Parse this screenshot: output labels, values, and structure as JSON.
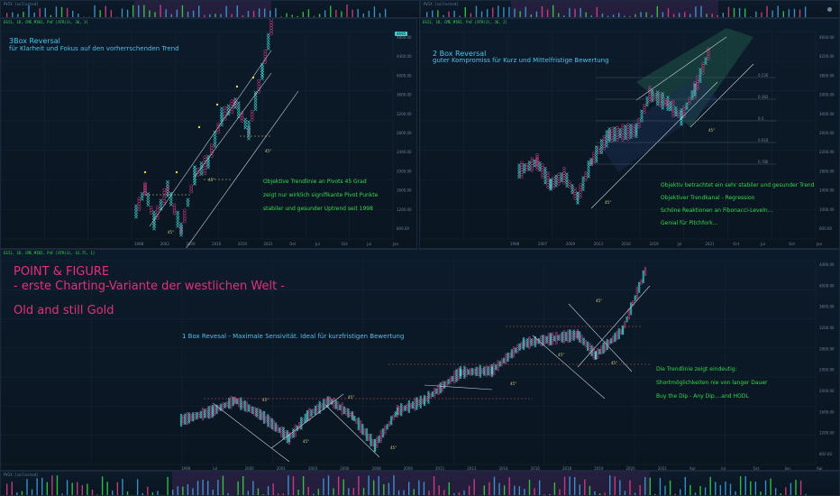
{
  "colors": {
    "bg": "#0b1522",
    "rise": "#3fd6d0",
    "fall": "#e0418c",
    "grid": "#15283a",
    "cyan_text": "#4ec3e6",
    "green_text": "#36d94a",
    "pink_text": "#e3317a",
    "trend": "#c8d2dc"
  },
  "top_volume_left": {
    "label": "PVIX [sollected]"
  },
  "top_volume_right": {
    "label": "PVIX [sollected]"
  },
  "panel_top_left": {
    "header": "ESI1, 1D, CME_MINI, PnF [ATR(3), 36, 3]",
    "title": "3Box Reversal",
    "subtitle": "für Klarheit und Fokus auf den vorherrschenden Trend",
    "notes": [
      "Objektive Trendlinie an Pivots 45 Grad",
      "zeigt nur wirklich signifikante Pivot Punkte",
      "stabiler und gesunder Uptrend seit 1998"
    ],
    "x_ticks": [
      "1998",
      "2002",
      "2009",
      "2016",
      "2019",
      "2021",
      "Oct",
      "Jul",
      "Oct",
      "Jul",
      "Jan"
    ],
    "y_ticks": [
      "4800.00",
      "4400.00",
      "4000.00",
      "3600.00",
      "3200.00",
      "2800.00",
      "2400.00",
      "2000.00",
      "1600.00",
      "1200.00",
      "800.00"
    ],
    "angle_labels": [
      "45°",
      "45°",
      "45°"
    ]
  },
  "panel_top_right": {
    "header": "ESI1, 1D, CME_MINI, PnF [ATR(3), 36, 2]",
    "title": "2 Box Reversal",
    "subtitle": "guter Kompromiss für Kurz und Mittelfristige Bewertung",
    "notes": [
      "Objektiv betrachtet ein sehr stabiler und gesunder Trend",
      "Objektiver Trendkanal - Regression",
      "Schöne Reaktionen an Fibonacci-Leveln...",
      "Genial für Pitchfork..."
    ],
    "fib_labels": [
      "0.236",
      "0.382",
      "0.5",
      "0.618",
      "0.786"
    ],
    "x_ticks": [
      "1998",
      "2007",
      "2009",
      "2013",
      "2016",
      "2019",
      "Jul",
      "2021",
      "Oct",
      "Jul",
      "Oct",
      "Jan"
    ],
    "y_ticks": [
      "4600.00",
      "4200.00",
      "3800.00",
      "3400.00",
      "3000.00",
      "2600.00",
      "2200.00",
      "1800.00",
      "1400.00",
      "1000.00",
      "600.00"
    ],
    "angle_labels": [
      "45°",
      "45°"
    ]
  },
  "panel_bottom": {
    "header": "ESI1, 1D, CME_MINI, PnF [ATR(3), 41.75, 1]",
    "title_line1": "POINT & FIGURE",
    "title_line2": "- erste Charting-Variante der westlichen Welt -",
    "title_line3": "Old and still Gold",
    "blue_note": "1 Box Revesal - Maximale Sensivität. Ideal für kurzfristigen Bewertung",
    "notes": [
      "Die Trendlinie zeigt eindeutig:",
      "Shortmöglichkeiten nie von langer Dauer",
      "Buy the Dip - Any Dip....and HODL"
    ],
    "x_ticks": [
      "1998",
      "Jul",
      "2000",
      "2001",
      "2003",
      "2006",
      "2008",
      "2009",
      "2011",
      "2013",
      "2014",
      "2016",
      "2018",
      "2019",
      "2020",
      "2021",
      "Apr",
      "Jul",
      "Oct",
      "Jan",
      "Apr"
    ],
    "y_ticks": [
      "4400.00",
      "4000.00",
      "3600.00",
      "3200.00",
      "2800.00",
      "2400.00",
      "2000.00",
      "1600.00",
      "1200.00",
      "800.00"
    ],
    "angle_labels": [
      "45°",
      "45°",
      "45°",
      "45°",
      "45°",
      "45°",
      "45°",
      "45°"
    ]
  },
  "bottom_volume": {
    "label": "PVIX [sollected]"
  }
}
